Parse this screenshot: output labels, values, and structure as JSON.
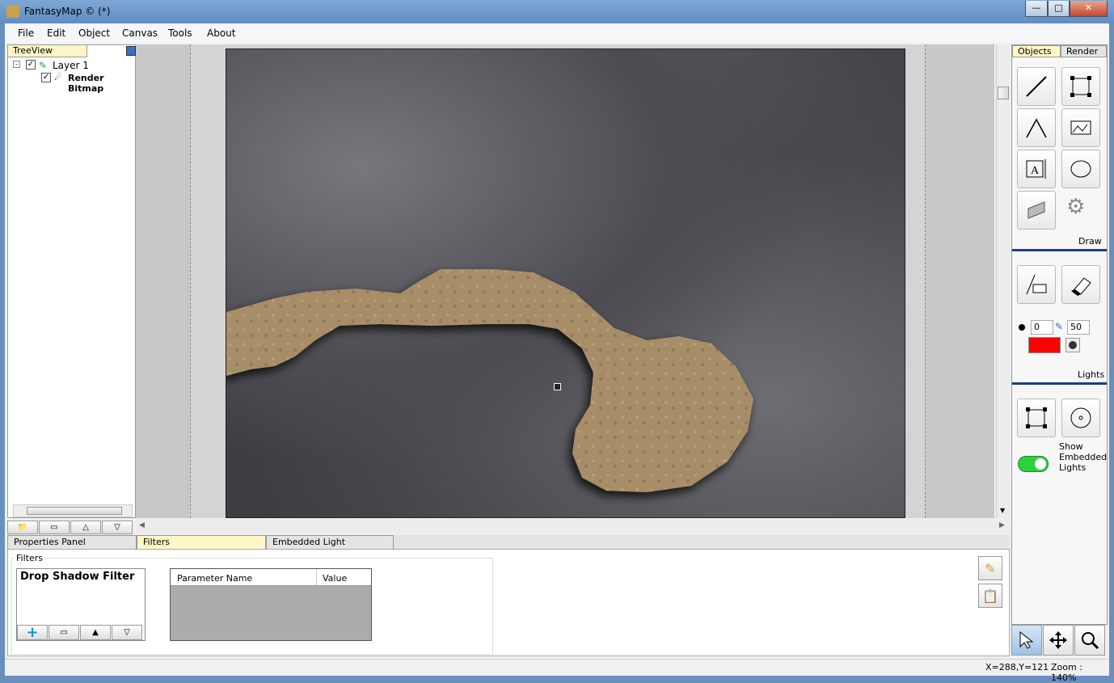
{
  "window": {
    "title": "FantasyMap © (*)",
    "min": "0",
    "max": "1",
    "close": "r"
  },
  "menu": [
    "File",
    "Edit",
    "Object",
    "Canvas",
    "Tools",
    "About"
  ],
  "treeview": {
    "tab": "TreeView",
    "items": [
      {
        "label": "Layer 1",
        "checked": true
      },
      {
        "label": "Render Bitmap",
        "checked": true
      }
    ]
  },
  "right_panel": {
    "tabs": [
      "Objects",
      "Render"
    ],
    "draw_label": "Draw",
    "lights_label": "Lights",
    "brush_size": "0",
    "opacity": "50",
    "color": "#ff0000",
    "embedded_lights_label": "Show Embedded Lights",
    "embedded_lights_on": true
  },
  "bottom": {
    "tabs": [
      "Properties Panel",
      "Filters",
      "Embedded Light"
    ],
    "group_label": "Filters",
    "filter_item": "Drop Shadow Filter",
    "table_headers": [
      "Parameter Name",
      "Value"
    ]
  },
  "status": {
    "coords": "X=288,Y=121",
    "zoom": "Zoom : 140%"
  },
  "icons": [
    "line-tool-icon",
    "rectangle-select-icon",
    "polygon-tool-icon",
    "image-tool-icon",
    "text-tool-icon",
    "ellipse-tool-icon",
    "texture-tool-icon",
    "settings-gears-icon",
    "image-brush-icon",
    "eraser-icon",
    "light-rect-icon",
    "light-circle-icon",
    "select-arrow-icon",
    "move-icon",
    "zoom-icon"
  ],
  "colors": {
    "path_fill": "#a78d68",
    "path_shadow": "#2a2a2e"
  }
}
